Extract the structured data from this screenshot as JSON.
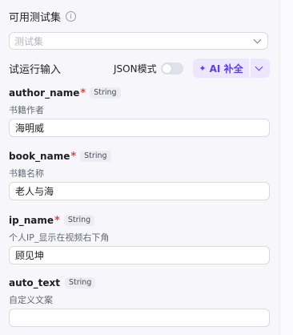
{
  "test_set": {
    "title": "可用测试集",
    "info_icon": "info-icon",
    "placeholder": "测试集"
  },
  "run_input": {
    "title": "试运行输入",
    "json_mode_label": "JSON模式",
    "json_mode_on": false,
    "ai_button_label": "AI 补全",
    "accent_color": "#5b3fe4"
  },
  "fields": [
    {
      "name": "author_name",
      "required": "*",
      "type": "String",
      "description": "书籍作者",
      "value": "海明威"
    },
    {
      "name": "book_name",
      "required": "*",
      "type": "String",
      "description": "书籍名称",
      "value": "老人与海"
    },
    {
      "name": "ip_name",
      "required": "*",
      "type": "String",
      "description": "个人IP_显示在视频右下角",
      "value": "顾见坤"
    },
    {
      "name": "auto_text",
      "required": "",
      "type": "String",
      "description": "自定义文案",
      "value": ""
    }
  ]
}
